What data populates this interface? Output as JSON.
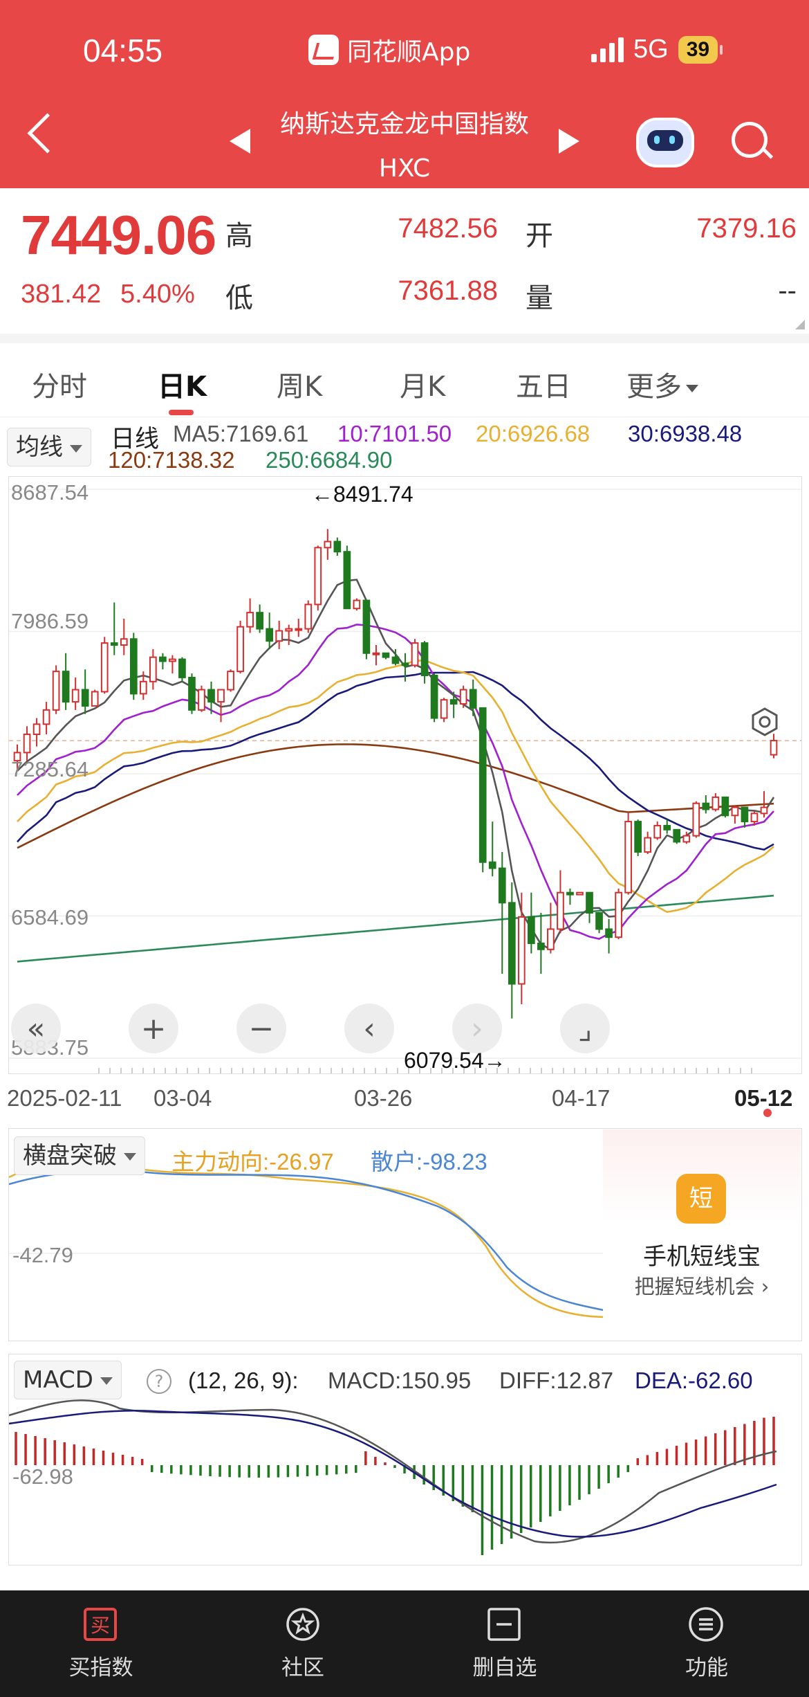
{
  "status": {
    "time": "04:55",
    "app": "同花顺App",
    "network": "5G",
    "battery": "39"
  },
  "header": {
    "name": "纳斯达克金龙中国指数",
    "code": "HXC"
  },
  "quote": {
    "price": "7449.06",
    "change": "381.42",
    "change_pct": "5.40%",
    "high_label": "高",
    "high": "7482.56",
    "low_label": "低",
    "low": "7361.88",
    "open_label": "开",
    "open": "7379.16",
    "vol_label": "量",
    "vol": "--"
  },
  "tabs": [
    "分时",
    "日K",
    "周K",
    "月K",
    "五日",
    "更多"
  ],
  "active_tab": "日K",
  "ma": {
    "selector": "均线",
    "period": "日线",
    "ma5": "MA5:7169.61",
    "ma10": "10:7101.50",
    "ma20": "20:6926.68",
    "ma30": "30:6938.48",
    "ma120": "120:7138.32",
    "ma250": "250:6684.90"
  },
  "colors": {
    "ma5": "#555555",
    "ma10": "#a020d0",
    "ma20": "#e8b030",
    "ma30": "#1a1a7a",
    "ma120": "#8a3a10",
    "ma250": "#2a8a5a",
    "up": "#d32f2f",
    "down": "#1f7a1f",
    "accent": "#e84747"
  },
  "chart_data": {
    "type": "candlestick",
    "y_ticks": [
      "8687.54",
      "7986.59",
      "7285.64",
      "6584.69",
      "5883.75"
    ],
    "ylim": [
      5883.75,
      8687.54
    ],
    "max_label": "←8491.74",
    "min_label": "6079.54→",
    "last_close": 7449.06,
    "x_ticks": [
      "2025-02-11",
      "03-04",
      "03-26",
      "04-17",
      "05-12"
    ],
    "ohlc": [
      [
        7350,
        7430,
        7300,
        7390
      ],
      [
        7390,
        7520,
        7350,
        7480
      ],
      [
        7480,
        7560,
        7420,
        7530
      ],
      [
        7530,
        7640,
        7480,
        7600
      ],
      [
        7600,
        7820,
        7580,
        7790
      ],
      [
        7790,
        7880,
        7600,
        7640
      ],
      [
        7640,
        7760,
        7600,
        7700
      ],
      [
        7700,
        7800,
        7580,
        7620
      ],
      [
        7620,
        7700,
        7620,
        7690
      ],
      [
        7690,
        7960,
        7680,
        7930
      ],
      [
        7930,
        8130,
        7870,
        7920
      ],
      [
        7920,
        8050,
        7870,
        7950
      ],
      [
        7950,
        7980,
        7650,
        7680
      ],
      [
        7680,
        7790,
        7650,
        7740
      ],
      [
        7740,
        7900,
        7700,
        7860
      ],
      [
        7860,
        7880,
        7800,
        7840
      ],
      [
        7840,
        7870,
        7780,
        7850
      ],
      [
        7850,
        7860,
        7740,
        7760
      ],
      [
        7760,
        7780,
        7580,
        7600
      ],
      [
        7600,
        7720,
        7590,
        7700
      ],
      [
        7700,
        7740,
        7580,
        7640
      ],
      [
        7640,
        7700,
        7540,
        7700
      ],
      [
        7700,
        7800,
        7690,
        7790
      ],
      [
        7790,
        8040,
        7780,
        8010
      ],
      [
        8010,
        8150,
        7980,
        8080
      ],
      [
        8080,
        8120,
        7980,
        8000
      ],
      [
        8000,
        8080,
        7900,
        7940
      ],
      [
        7940,
        8040,
        7900,
        7990
      ],
      [
        7990,
        8020,
        7920,
        8000
      ],
      [
        8000,
        8050,
        7960,
        8000
      ],
      [
        8000,
        8140,
        7980,
        8120
      ],
      [
        8120,
        8410,
        8090,
        8400
      ],
      [
        8400,
        8491.74,
        8340,
        8430
      ],
      [
        8430,
        8450,
        8360,
        8380
      ],
      [
        8380,
        8410,
        8180,
        8100
      ],
      [
        8100,
        8150,
        8090,
        8140
      ],
      [
        8140,
        8110,
        7850,
        7880
      ],
      [
        7880,
        7920,
        7820,
        7880
      ],
      [
        7880,
        7870,
        7850,
        7860
      ],
      [
        7860,
        7900,
        7820,
        7830
      ],
      [
        7830,
        7880,
        7740,
        7820
      ],
      [
        7820,
        7950,
        7810,
        7930
      ],
      [
        7930,
        7940,
        7730,
        7770
      ],
      [
        7770,
        7780,
        7540,
        7560
      ],
      [
        7560,
        7660,
        7540,
        7650
      ],
      [
        7650,
        7690,
        7560,
        7630
      ],
      [
        7630,
        7720,
        7610,
        7700
      ],
      [
        7700,
        7750,
        7570,
        7610
      ],
      [
        7610,
        7600,
        6800,
        6850
      ],
      [
        6850,
        7050,
        6780,
        6820
      ],
      [
        6820,
        6900,
        6300,
        6650
      ],
      [
        6650,
        6750,
        6079.54,
        6250
      ],
      [
        6250,
        6700,
        6150,
        6580
      ],
      [
        6580,
        6700,
        6400,
        6450
      ],
      [
        6450,
        6600,
        6300,
        6420
      ],
      [
        6420,
        6650,
        6400,
        6520
      ],
      [
        6520,
        6810,
        6500,
        6700
      ],
      [
        6700,
        6720,
        6640,
        6690
      ],
      [
        6690,
        6690,
        6690,
        6700
      ],
      [
        6700,
        6600,
        6550,
        6600
      ],
      [
        6600,
        6580,
        6500,
        6520
      ],
      [
        6520,
        6570,
        6400,
        6480
      ],
      [
        6480,
        6720,
        6470,
        6700
      ],
      [
        6700,
        7100,
        6690,
        7050
      ],
      [
        7050,
        7060,
        6880,
        6900
      ],
      [
        6900,
        7000,
        6890,
        6970
      ],
      [
        6970,
        7050,
        6960,
        7030
      ],
      [
        7030,
        7060,
        6990,
        7010
      ],
      [
        7010,
        7000,
        6940,
        6950
      ],
      [
        6950,
        7000,
        6940,
        6980
      ],
      [
        6980,
        7150,
        6970,
        7140
      ],
      [
        7140,
        7180,
        7090,
        7110
      ],
      [
        7110,
        7190,
        7100,
        7170
      ],
      [
        7170,
        7160,
        7070,
        7080
      ],
      [
        7080,
        7130,
        7040,
        7120
      ],
      [
        7120,
        7100,
        7020,
        7050
      ],
      [
        7050,
        7100,
        7030,
        7090
      ],
      [
        7090,
        7200,
        7070,
        7120
      ],
      [
        7379.16,
        7482.56,
        7361.88,
        7449.06
      ]
    ],
    "ma_start": {
      "ma5": 7300,
      "ma10": 7180,
      "ma20": 7050,
      "ma30": 6950,
      "ma120": 6920,
      "ma250": 6360
    },
    "ma_end": {
      "ma5": 7169.61,
      "ma10": 7101.5,
      "ma20": 6926.68,
      "ma30": 6938.48,
      "ma120": 7138.32,
      "ma250": 6684.9
    }
  },
  "controls": {
    "first": "«",
    "zoom_in": "+",
    "zoom_out": "−",
    "prev": "‹",
    "next": "›",
    "fullscreen": "⌟"
  },
  "ind2": {
    "selector": "横盘突破",
    "main": "主力动向:-26.97",
    "retail": "散户:-98.23",
    "y_tick": "-42.79"
  },
  "ad": {
    "icon": "短",
    "title": "手机短线宝",
    "sub": "把握短线机会 ›"
  },
  "macd": {
    "selector": "MACD",
    "help": "?",
    "params": "(12, 26, 9):",
    "macd": "MACD:150.95",
    "diff": "DIFF:12.87",
    "dea": "DEA:-62.60",
    "y_tick": "-62.98"
  },
  "nav": [
    {
      "label": "买指数",
      "icon": "buy-icon"
    },
    {
      "label": "社区",
      "icon": "community-icon"
    },
    {
      "label": "删自选",
      "icon": "remove-watchlist-icon"
    },
    {
      "label": "功能",
      "icon": "menu-icon"
    }
  ]
}
